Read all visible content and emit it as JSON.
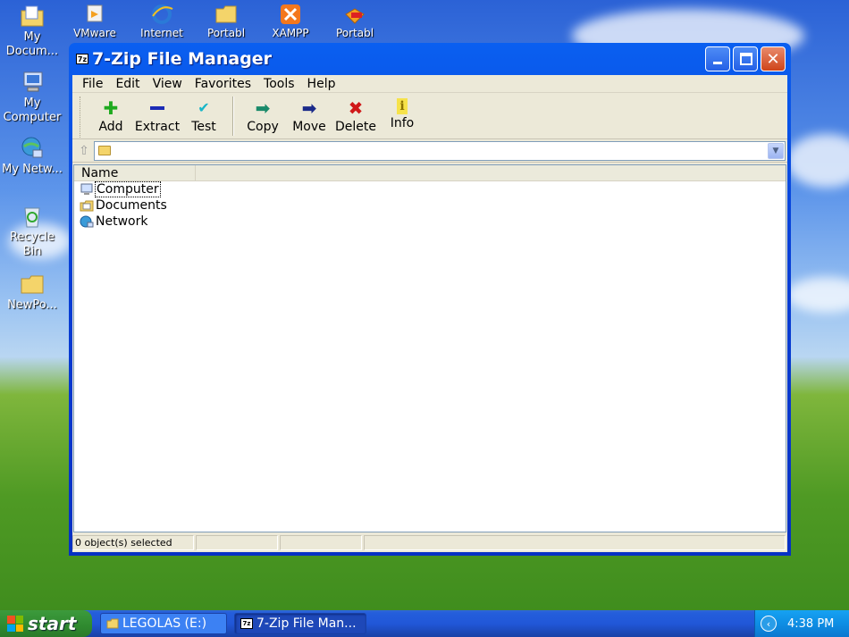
{
  "desktop": {
    "left_icons": [
      {
        "label": "My Docum...",
        "icon": "my-documents-icon"
      },
      {
        "label": "My Computer",
        "icon": "my-computer-icon"
      },
      {
        "label": "My Netw...",
        "icon": "network-icon"
      },
      {
        "label": "Recycle Bin",
        "icon": "recycle-bin-icon"
      },
      {
        "label": "NewPo...",
        "icon": "folder-icon"
      }
    ],
    "top_icons": [
      {
        "label": "VMware",
        "icon": "vmware-icon"
      },
      {
        "label": "Internet",
        "icon": "internet-explorer-icon"
      },
      {
        "label": "Portabl",
        "icon": "folder-icon"
      },
      {
        "label": "XAMPP",
        "icon": "xampp-icon"
      },
      {
        "label": "Portabl",
        "icon": "7zip-portable-icon"
      }
    ]
  },
  "window": {
    "title": "7-Zip File Manager",
    "logo": "7z",
    "menu": [
      "File",
      "Edit",
      "View",
      "Favorites",
      "Tools",
      "Help"
    ],
    "toolbar": {
      "add": "Add",
      "extract": "Extract",
      "test": "Test",
      "copy": "Copy",
      "move": "Move",
      "delete": "Delete",
      "info": "Info"
    },
    "address": "",
    "column_header": "Name",
    "items": [
      {
        "name": "Computer",
        "icon": "computer-icon"
      },
      {
        "name": "Documents",
        "icon": "documents-icon"
      },
      {
        "name": "Network",
        "icon": "network-icon"
      }
    ],
    "status": "0 object(s) selected"
  },
  "taskbar": {
    "start": "start",
    "tasks": [
      "LEGOLAS (E:)",
      "7-Zip File Man..."
    ],
    "clock": "4:38 PM"
  },
  "colors": {
    "title_blue": "#0a5ff0",
    "client_bg": "#ece9d8",
    "start_green": "#3c9a3c",
    "tray_blue": "#0e8ee4"
  }
}
